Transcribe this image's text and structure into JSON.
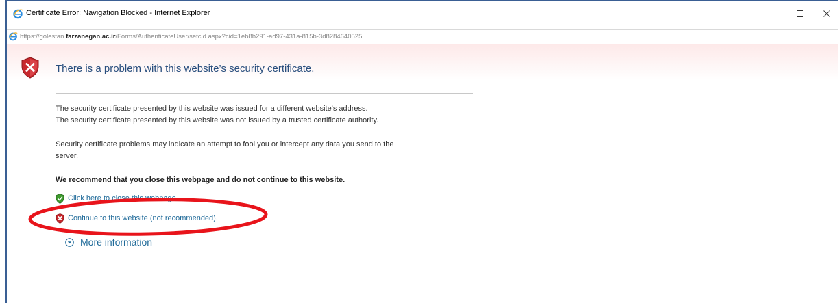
{
  "window": {
    "title": "Certificate Error: Navigation Blocked - Internet Explorer",
    "controls": {
      "minimize": "minimize-icon",
      "maximize": "maximize-icon",
      "close": "close-icon"
    }
  },
  "address": {
    "url_prefix": "https://golestan.",
    "url_domain": "farzanegan.ac.ir",
    "url_suffix": "/Forms/AuthenticateUser/setcid.aspx?cid=1eb8b291-ad97-431a-815b-3d8284640525"
  },
  "page": {
    "heading": "There is a problem with this website’s security certificate.",
    "paragraph1_line1": "The security certificate presented by this website was issued for a different website's address.",
    "paragraph1_line2": "The security certificate presented by this website was not issued by a trusted certificate authority.",
    "paragraph2_line1": "Security certificate problems may indicate an attempt to fool you or intercept any data you send to the",
    "paragraph2_line2": "server.",
    "recommendation": "We recommend that you close this webpage and do not continue to this website.",
    "close_link": "Click here to close this webpage.",
    "continue_link": "Continue to this website (not recommended).",
    "more_info": "More information"
  },
  "colors": {
    "heading": "#2a4f7e",
    "link": "#1f6a99",
    "annotation": "#e8141b",
    "error_shield": "#c8282d",
    "safe_shield": "#3f9b2f"
  },
  "icons": {
    "title_icon": "ie-icon",
    "address_icon": "ie-icon",
    "main_icon": "shield-error-icon",
    "close_link_icon": "green-shield-icon",
    "continue_link_icon": "red-shield-icon",
    "more_info_icon": "chevron-down-circle-icon"
  }
}
